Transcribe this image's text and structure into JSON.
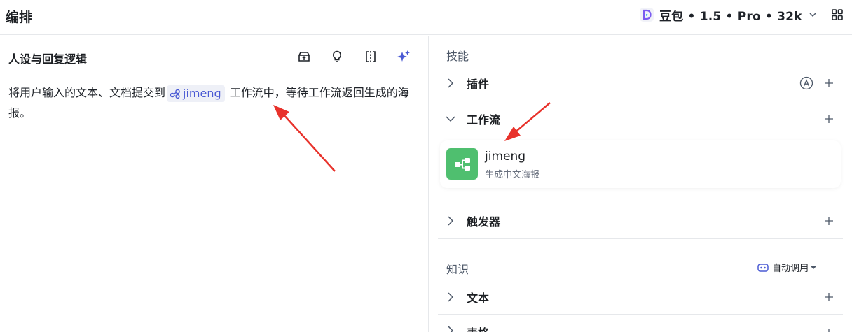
{
  "header": {
    "title": "编排",
    "model_label": "豆包 • 1.5 • Pro • 32k"
  },
  "editor": {
    "title": "人设与回复逻辑",
    "prompt_before": "将用户输入的文本、文档提交到",
    "workflow_chip": "jimeng",
    "prompt_after": " 工作流中，等待工作流返回生成的海报。"
  },
  "skills": {
    "group_label": "技能",
    "plugins_label": "插件",
    "workflow_label": "工作流",
    "workflow_item": {
      "name": "jimeng",
      "description": "生成中文海报"
    },
    "triggers_label": "触发器"
  },
  "knowledge": {
    "group_label": "知识",
    "auto_call_label": "自动调用",
    "text_label": "文本",
    "table_label": "表格"
  },
  "colors": {
    "accent": "#4a5ad4",
    "workflow_icon_bg": "#4fbf6f",
    "annotation_arrow": "#e8322b"
  }
}
